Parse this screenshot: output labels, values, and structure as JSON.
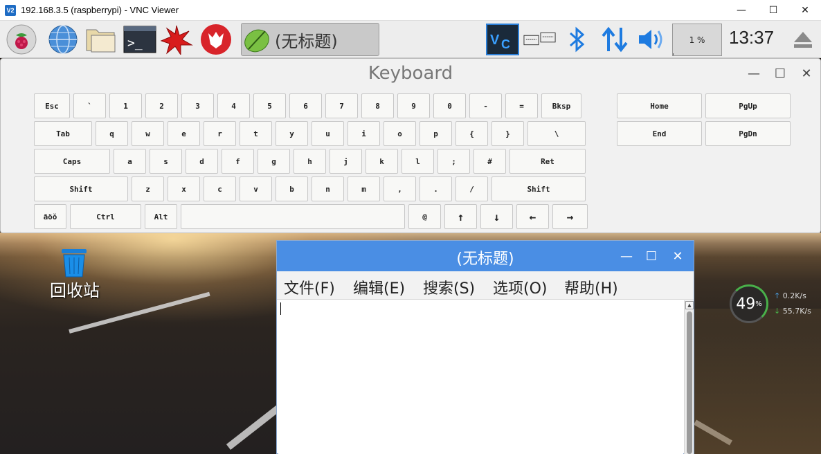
{
  "vnc": {
    "title": "192.168.3.5 (raspberrypi) - VNC Viewer",
    "icon_text": "V2"
  },
  "taskbar": {
    "launchers": [
      "raspberry-menu-icon",
      "web-browser-icon",
      "file-manager-icon",
      "terminal-icon",
      "mathematica-icon",
      "wolfram-icon"
    ],
    "task_label": "(无标题)",
    "cpu": "1 %",
    "clock": "13:37",
    "tray": [
      "vnc-server-icon",
      "keyboard-icon",
      "bluetooth-icon",
      "network-icon",
      "volume-icon",
      "eject-icon"
    ]
  },
  "keyboard": {
    "title": "Keyboard",
    "rows": [
      [
        "Esc",
        "`",
        "1",
        "2",
        "3",
        "4",
        "5",
        "6",
        "7",
        "8",
        "9",
        "0",
        "-",
        "=",
        "Bksp"
      ],
      [
        "Tab",
        "q",
        "w",
        "e",
        "r",
        "t",
        "y",
        "u",
        "i",
        "o",
        "p",
        "{",
        "}",
        "\\"
      ],
      [
        "Caps",
        "a",
        "s",
        "d",
        "f",
        "g",
        "h",
        "j",
        "k",
        "l",
        ";",
        "#",
        "Ret"
      ],
      [
        "Shift",
        "z",
        "x",
        "c",
        "v",
        "b",
        "n",
        "m",
        ",",
        ".",
        "/",
        "Shift"
      ],
      [
        "āöŏ",
        "Ctrl",
        "Alt",
        "",
        "@",
        "↑",
        "↓",
        "←",
        "→"
      ]
    ],
    "nav": [
      "Home",
      "PgUp",
      "End",
      "PgDn"
    ]
  },
  "desktop": {
    "trash_label": "回收站",
    "netmon": {
      "percent": "49",
      "unit": "%",
      "up": "0.2K/s",
      "down": "55.7K/s"
    }
  },
  "editor": {
    "title": "(无标题)",
    "menus": [
      "文件(F)",
      "编辑(E)",
      "搜索(S)",
      "选项(O)",
      "帮助(H)"
    ],
    "content": ""
  }
}
